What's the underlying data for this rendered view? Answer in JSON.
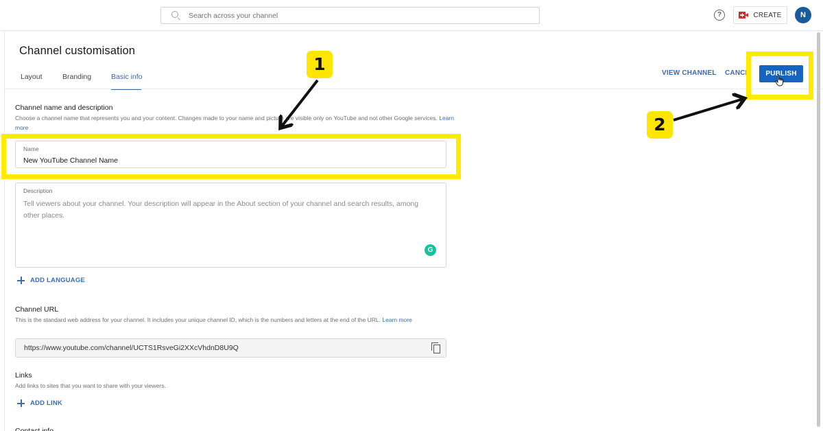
{
  "topbar": {
    "search_placeholder": "Search across your channel",
    "help_icon": "question-circle-icon",
    "create_label": "CREATE",
    "create_icon": "video-camera-plus-icon",
    "avatar_initial": "N",
    "avatar_color": "#1a5a9c"
  },
  "page": {
    "title": "Channel customisation",
    "tabs": [
      {
        "label": "Layout",
        "active": false
      },
      {
        "label": "Branding",
        "active": false
      },
      {
        "label": "Basic info",
        "active": true
      }
    ],
    "actions": {
      "view_channel": "VIEW CHANNEL",
      "cancel": "CANCEL",
      "publish": "PUBLISH"
    }
  },
  "form": {
    "name_section": {
      "title": "Channel name and description",
      "description": "Choose a channel name that represents you and your content. Changes made to your name and picture are visible only on YouTube and not other Google services.",
      "learn_more": "Learn more"
    },
    "name_field": {
      "label": "Name",
      "value": "New YouTube Channel Name"
    },
    "description_field": {
      "label": "Description",
      "placeholder": "Tell viewers about your channel. Your description will appear in the About section of your channel and search results, among other places."
    },
    "add_language": "ADD LANGUAGE",
    "url_section": {
      "title": "Channel URL",
      "description": "This is the standard web address for your channel. It includes your unique channel ID, which is the numbers and letters at the end of the URL.",
      "learn_more": "Learn more",
      "value": "https://www.youtube.com/channel/UCTS1RsveGi2XXcVhdnD8U9Q"
    },
    "links_section": {
      "title": "Links",
      "description": "Add links to sites that you want to share with your viewers.",
      "add_link": "ADD LINK"
    },
    "contact_section": {
      "title": "Contact info"
    }
  },
  "annotations": {
    "step1_label": "1",
    "step2_label": "2",
    "highlight_color": "#ffeb00",
    "accent_color": "#1565c0"
  }
}
